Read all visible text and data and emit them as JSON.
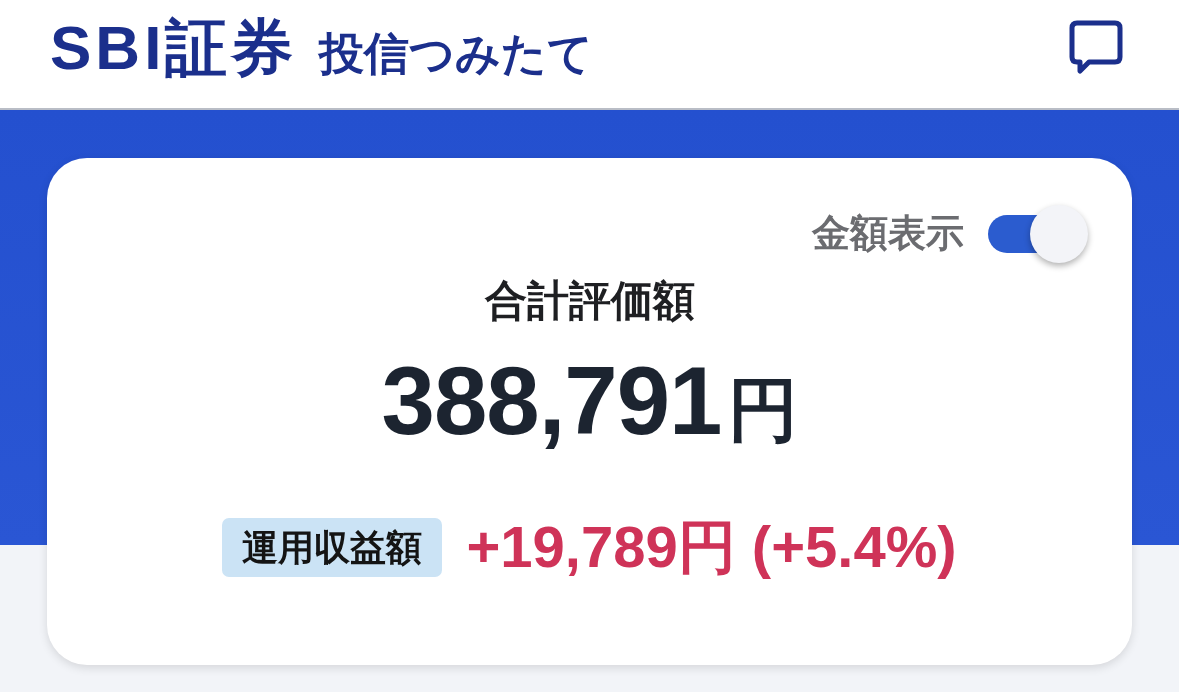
{
  "header": {
    "brand": "SBI証券",
    "service": "投信つみたて"
  },
  "summary": {
    "toggle": {
      "label": "金額表示",
      "on": true
    },
    "title": "合計評価額",
    "total": {
      "value": "388,791",
      "unit": "円"
    },
    "profit": {
      "label": "運用収益額",
      "value": "+19,789円 (+5.4%)"
    }
  }
}
